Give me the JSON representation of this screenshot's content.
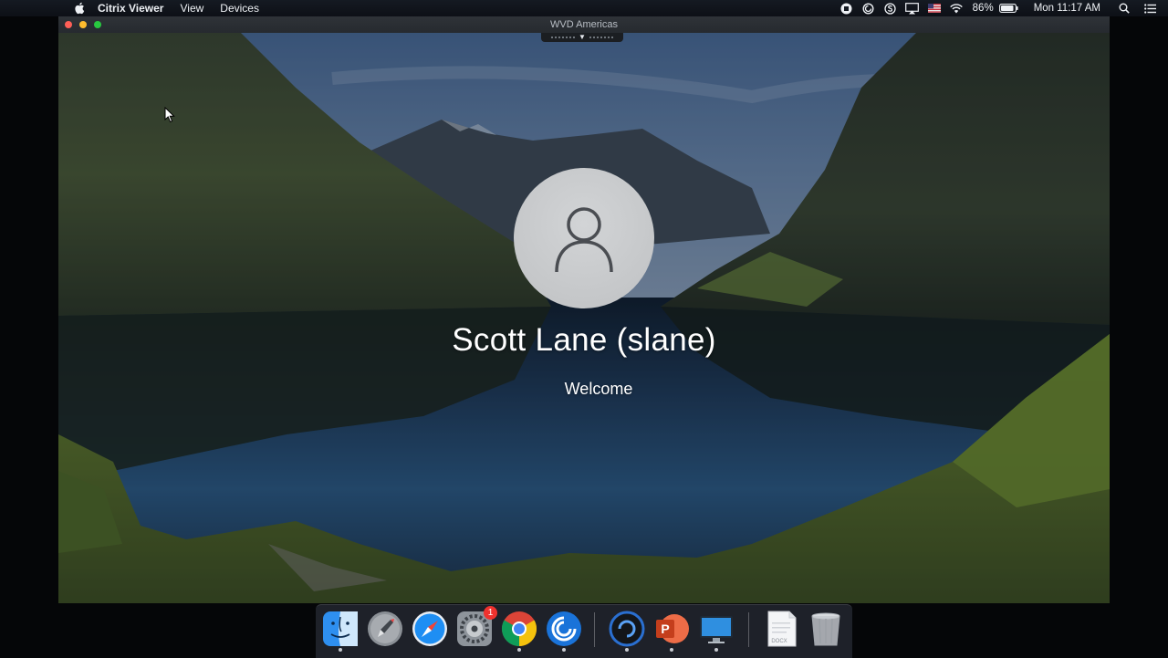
{
  "menubar": {
    "apple_icon": "apple-logo-icon",
    "app_name": "Citrix Viewer",
    "menus": [
      "View",
      "Devices"
    ],
    "status_icons": [
      "screen-record-icon",
      "citrix-receiver-icon",
      "skype-icon",
      "airplay-icon",
      "us-flag-icon",
      "wifi-icon"
    ],
    "battery_percent": "86%",
    "clock": "Mon 11:17 AM",
    "right_icons": [
      "spotlight-search-icon",
      "notification-center-icon"
    ]
  },
  "window": {
    "title": "WVD Americas",
    "controls": [
      "close",
      "minimize",
      "zoom"
    ]
  },
  "login": {
    "user_name": "Scott Lane (slane)",
    "status": "Welcome"
  },
  "dock": {
    "apps": [
      {
        "name": "Finder",
        "icon": "finder-icon",
        "running": true
      },
      {
        "name": "Launchpad",
        "icon": "launchpad-icon",
        "running": false
      },
      {
        "name": "Safari",
        "icon": "safari-icon",
        "running": false
      },
      {
        "name": "System Preferences",
        "icon": "system-preferences-icon",
        "running": false,
        "badge": "1"
      },
      {
        "name": "Google Chrome",
        "icon": "chrome-icon",
        "running": true
      },
      {
        "name": "Citrix Workspace",
        "icon": "citrix-workspace-icon",
        "running": true
      },
      {
        "name": "Citrix Viewer",
        "icon": "citrix-viewer-icon",
        "running": true
      },
      {
        "name": "PowerPoint",
        "icon": "powerpoint-icon",
        "running": true
      },
      {
        "name": "Remote Desktop",
        "icon": "remote-desktop-icon",
        "running": true
      },
      {
        "name": "Document",
        "icon": "docx-file-icon",
        "label": "DOCX"
      },
      {
        "name": "Trash",
        "icon": "trash-icon"
      }
    ]
  },
  "colors": {
    "close": "#fe5f57",
    "minimize": "#febc2e",
    "zoom": "#28c840",
    "badge": "#f0322e"
  }
}
